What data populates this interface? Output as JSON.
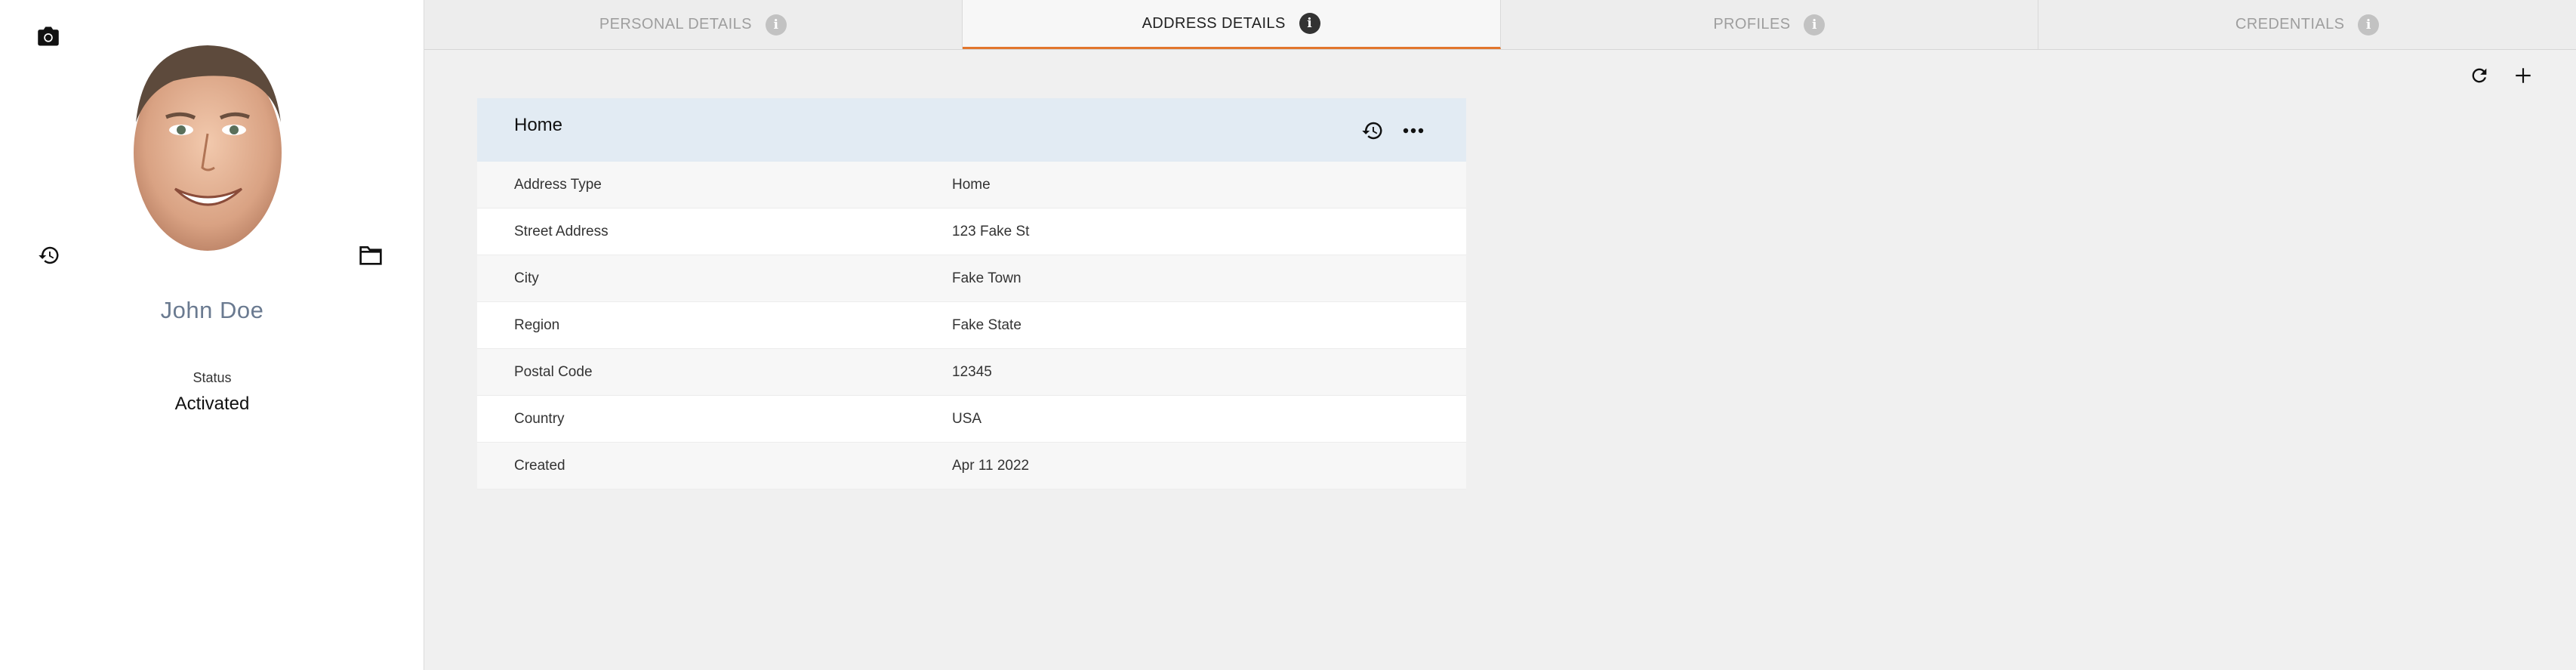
{
  "profile": {
    "name": "John Doe",
    "status_label": "Status",
    "status_value": "Activated",
    "avatar_icon": "person-photo",
    "camera_icon": "camera-icon",
    "history_icon": "history-icon",
    "folder_icon": "folder-icon"
  },
  "tabs": [
    {
      "label": "PERSONAL DETAILS",
      "active": false
    },
    {
      "label": "ADDRESS DETAILS",
      "active": true
    },
    {
      "label": "PROFILES",
      "active": false
    },
    {
      "label": "CREDENTIALS",
      "active": false
    }
  ],
  "toolbar": {
    "refresh_icon": "refresh-icon",
    "add_icon": "plus-icon"
  },
  "address_card": {
    "title": "Home",
    "rows": [
      {
        "label": "Address Type",
        "value": "Home"
      },
      {
        "label": "Street Address",
        "value": "123 Fake St"
      },
      {
        "label": "City",
        "value": "Fake Town"
      },
      {
        "label": "Region",
        "value": "Fake State"
      },
      {
        "label": "Postal Code",
        "value": "12345"
      },
      {
        "label": "Country",
        "value": "USA"
      },
      {
        "label": "Created",
        "value": "Apr 11 2022"
      }
    ]
  },
  "colors": {
    "accent": "#e2762d",
    "card_header": "#e2ebf3",
    "name_text": "#6a7a90"
  }
}
